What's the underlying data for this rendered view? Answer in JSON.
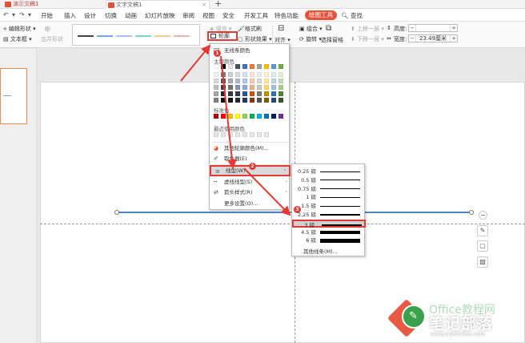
{
  "window": {
    "app_tab": "演示文稿1",
    "doc_tab": "文字文稿1",
    "add_tab": "+"
  },
  "menubar": {
    "items": [
      "开始",
      "插入",
      "设计",
      "切换",
      "动画",
      "幻灯片放映",
      "审阅",
      "视图",
      "安全",
      "开发工具",
      "特色功能",
      "绘图工具"
    ],
    "active": "绘图工具",
    "search": "查找"
  },
  "ribbon": {
    "edit_shape": "编辑形状",
    "text_box": "文本框",
    "merge_shape": "合并形状",
    "fill": "填充",
    "format_painter": "格式刷",
    "outline": "轮廓",
    "shape_effect": "形状效果",
    "align": "对齐",
    "group": "组合",
    "rotate": "旋转",
    "selection_pane": "选择窗格",
    "bring_forward": "上移一层",
    "send_backward": "下移一层",
    "height_label": "高度:",
    "width_label": "宽度:",
    "height_value": "",
    "width_value": "23.49厘米",
    "minus": "−",
    "plus": "+"
  },
  "colors": {
    "accent": "#e8513a",
    "highlight_border": "#e53935",
    "line_color": "#4a86c8"
  },
  "outline_menu": {
    "no_line": "无线条颜色",
    "theme_colors": "主题颜色",
    "standard_colors": "标准色",
    "recent_colors": "最近使用颜色",
    "more_colors": "其他轮廓颜色(M)...",
    "eyedropper": "取色器(E)",
    "line_type": "线型(W)",
    "dash_type": "虚线线型(S)",
    "arrow_style": "箭头样式(R)",
    "more_settings": "更多设置(O)..."
  },
  "line_weights": [
    {
      "label": "0.25 磅",
      "pt": 0.25
    },
    {
      "label": "0.5 磅",
      "pt": 0.5
    },
    {
      "label": "0.75 磅",
      "pt": 0.75
    },
    {
      "label": "1 磅",
      "pt": 1
    },
    {
      "label": "1.5 磅",
      "pt": 1.5
    },
    {
      "label": "2.25 磅",
      "pt": 2.25
    },
    {
      "label": "3 磅",
      "pt": 3
    },
    {
      "label": "4.5 磅",
      "pt": 4.5
    },
    {
      "label": "6 磅",
      "pt": 6
    }
  ],
  "selected_weight": "3 磅",
  "more_lines": "其他线条(M)...",
  "steps": [
    "1",
    "2",
    "3"
  ],
  "watermark": {
    "office": "Office教程网",
    "title": "笔记部落",
    "url": "www.notetribe.com"
  }
}
